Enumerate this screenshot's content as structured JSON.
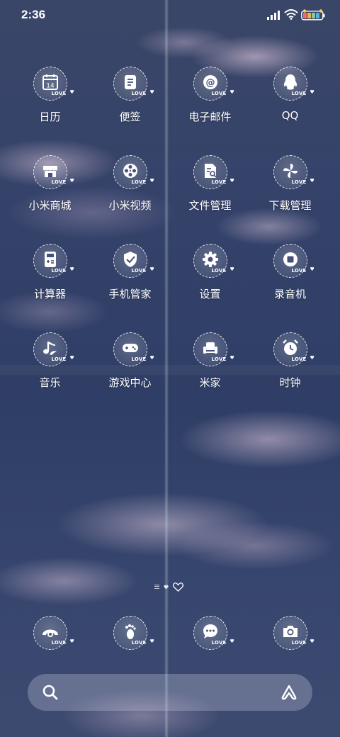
{
  "status_bar": {
    "time": "2:36"
  },
  "home": {
    "icon_badge_text": "LOVE",
    "apps": [
      {
        "label": "日历",
        "icon": "calendar-icon",
        "icon_text": "14"
      },
      {
        "label": "便签",
        "icon": "notes-icon"
      },
      {
        "label": "电子邮件",
        "icon": "email-icon",
        "icon_text": "@"
      },
      {
        "label": "QQ",
        "icon": "qq-penguin-icon"
      },
      {
        "label": "小米商城",
        "icon": "store-icon"
      },
      {
        "label": "小米视频",
        "icon": "film-reel-icon"
      },
      {
        "label": "文件管理",
        "icon": "file-manager-icon"
      },
      {
        "label": "下载管理",
        "icon": "pinwheel-icon"
      },
      {
        "label": "计算器",
        "icon": "calculator-icon"
      },
      {
        "label": "手机管家",
        "icon": "shield-icon"
      },
      {
        "label": "设置",
        "icon": "gear-icon"
      },
      {
        "label": "录音机",
        "icon": "record-icon"
      },
      {
        "label": "音乐",
        "icon": "music-note-icon"
      },
      {
        "label": "游戏中心",
        "icon": "gamepad-icon"
      },
      {
        "label": "米家",
        "icon": "armchair-icon"
      },
      {
        "label": "时钟",
        "icon": "alarm-clock-icon"
      }
    ],
    "dock": [
      {
        "icon": "phone-icon"
      },
      {
        "icon": "footprint-icon"
      },
      {
        "icon": "message-icon"
      },
      {
        "icon": "camera-icon"
      }
    ]
  },
  "search_bar": {
    "icon": "search-icon",
    "assistant_icon": "voice-assistant-icon"
  }
}
